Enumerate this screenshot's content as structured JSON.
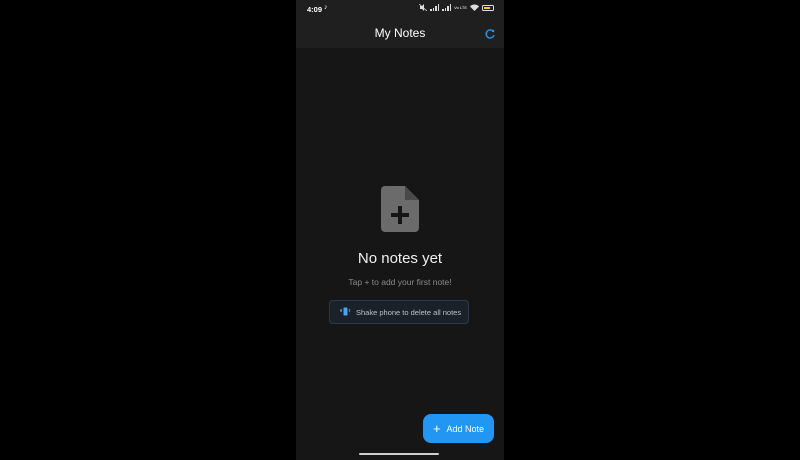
{
  "status_bar": {
    "time": "4:09",
    "icons": [
      "tiktok-icon",
      "mute-icon",
      "signal-icon",
      "signal-icon",
      "volte-icon",
      "wifi-icon",
      "battery-icon"
    ],
    "volte_label": "Vo LTE"
  },
  "app_bar": {
    "title": "My Notes",
    "action_icon": "refresh-icon"
  },
  "empty_state": {
    "icon": "file-plus-icon",
    "title": "No notes yet",
    "subtitle": "Tap + to add your first note!",
    "hint": {
      "icon": "vibration-icon",
      "text": "Shake phone to delete all notes"
    }
  },
  "fab": {
    "icon": "plus-icon",
    "label": "Add Note"
  },
  "colors": {
    "background": "#161616",
    "app_bar": "#1f1f1f",
    "accent": "#2196f3",
    "icon_grey": "#6b6b6b"
  }
}
